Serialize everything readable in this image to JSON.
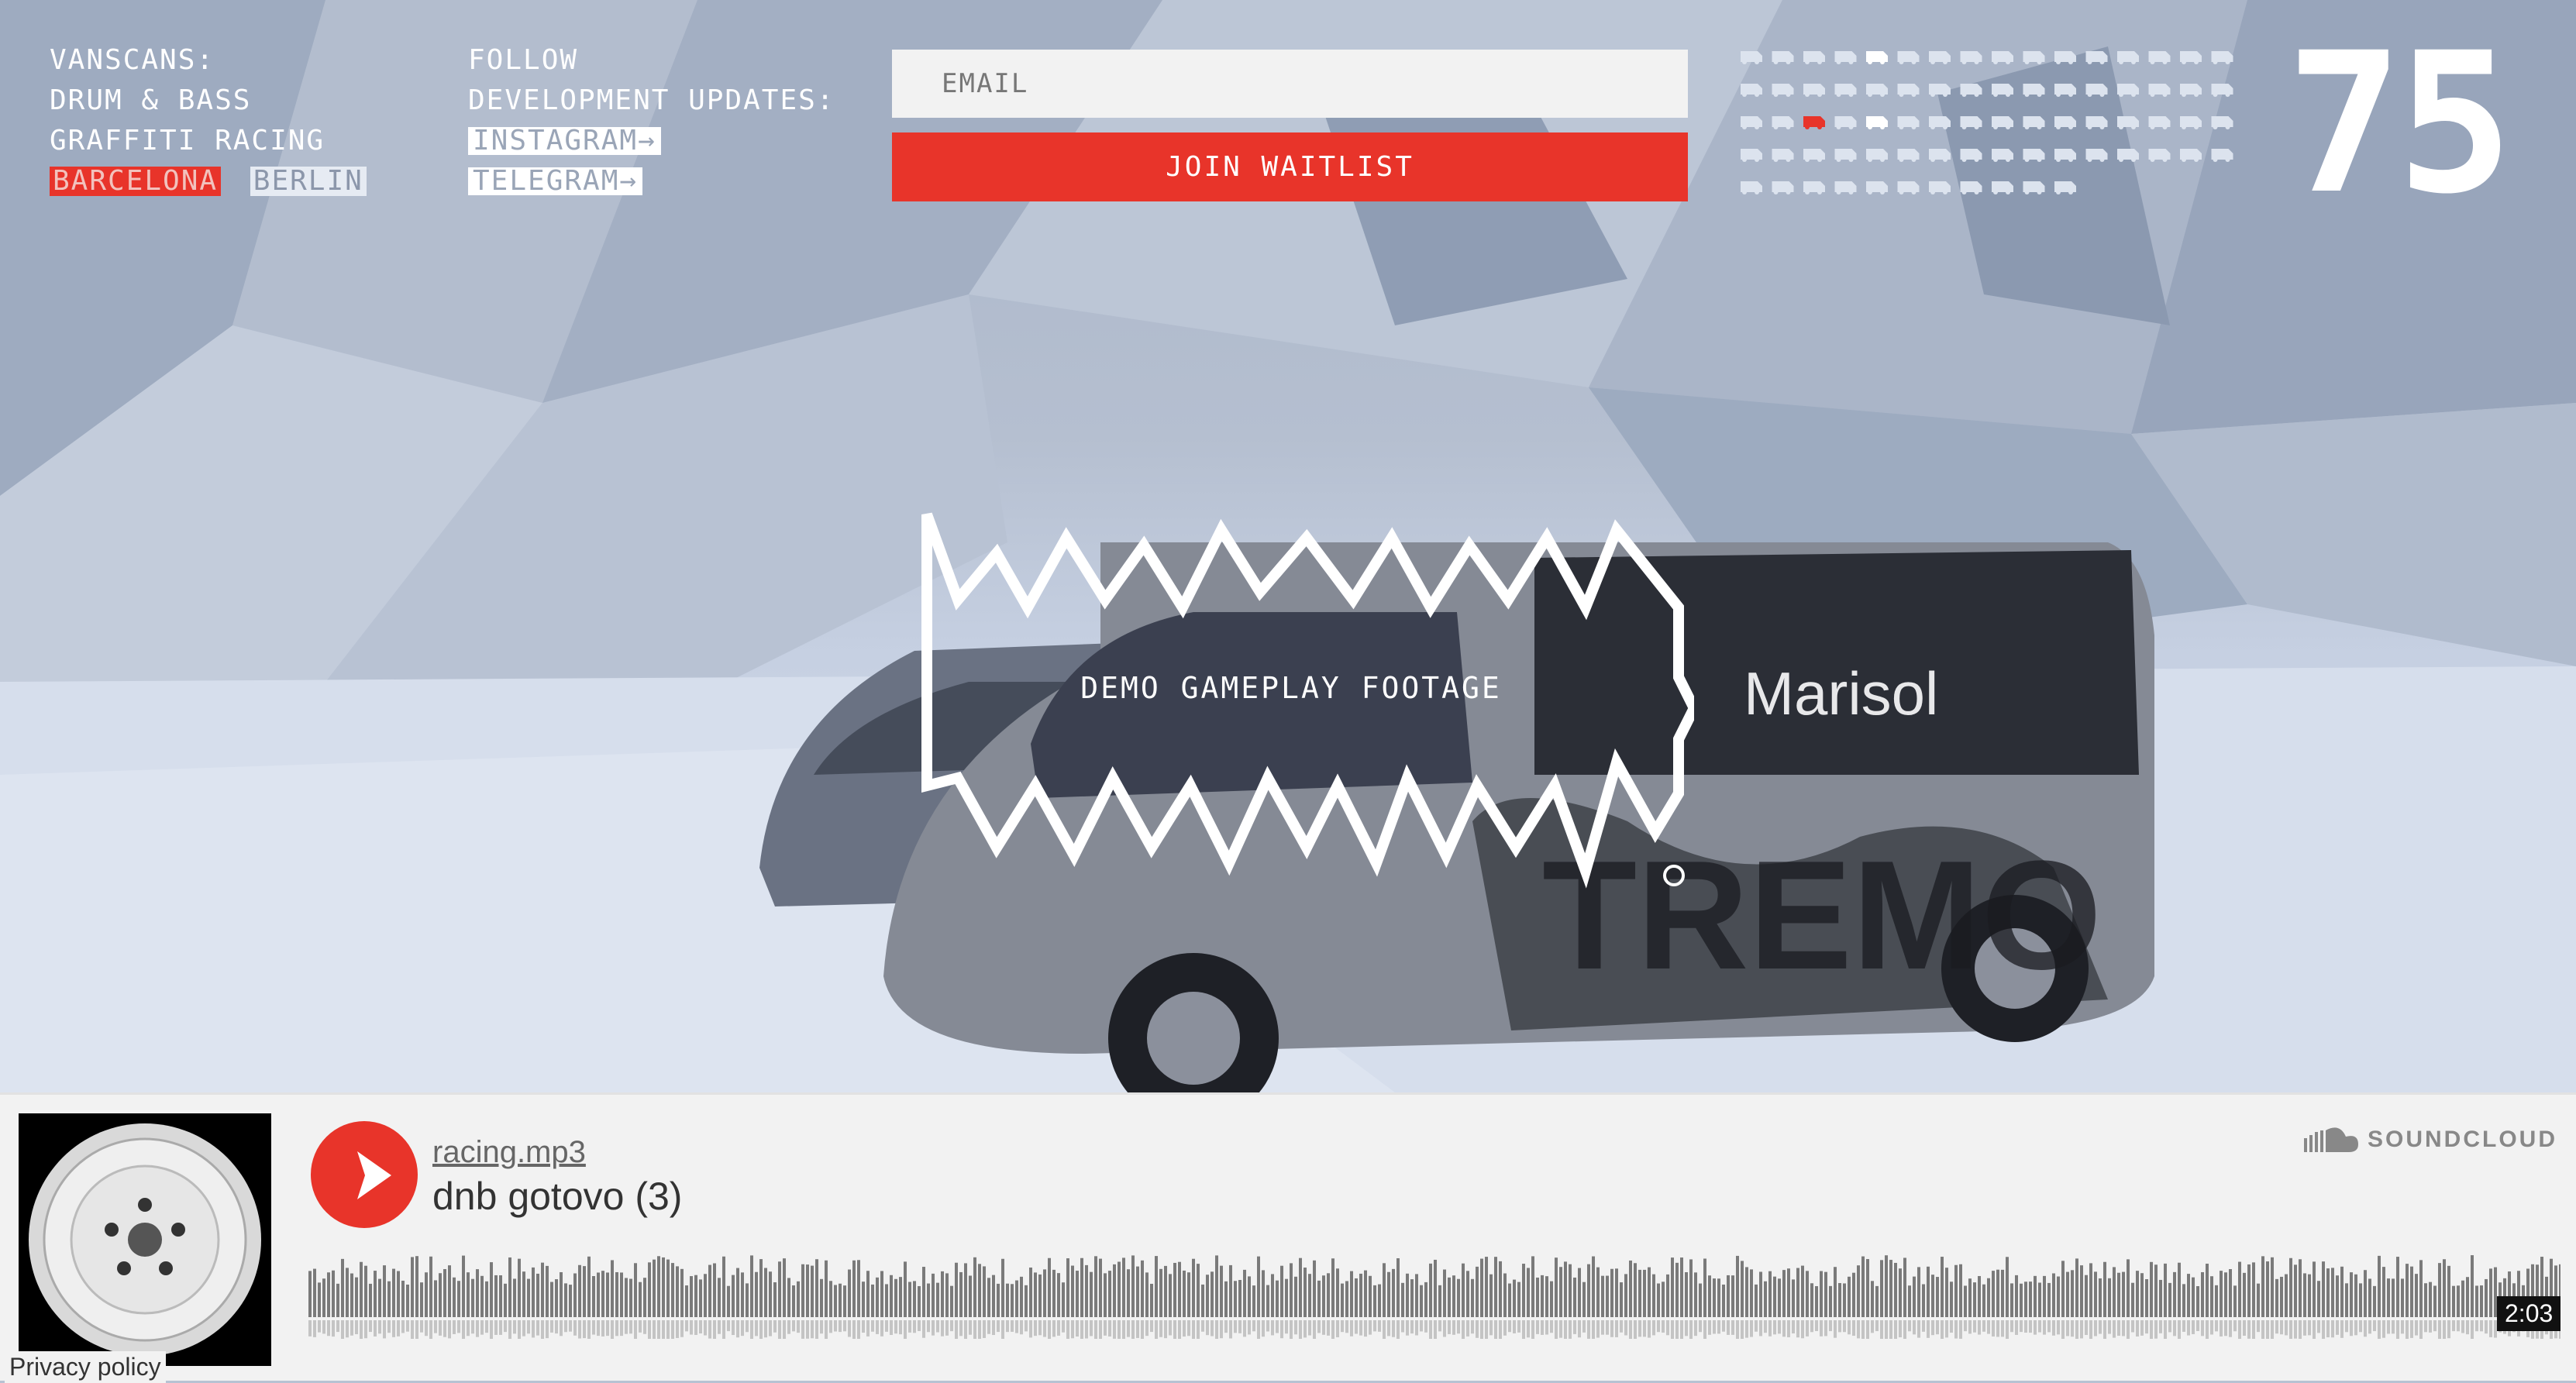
{
  "brand": {
    "line1": "VANSCANS:",
    "line2": "DRUM & BASS",
    "line3": "GRAFFITI RACING",
    "city_active": "BARCELONA",
    "city_other": "BERLIN"
  },
  "follow": {
    "line1": "FOLLOW",
    "line2": "DEVELOPMENT UPDATES:",
    "instagram": "INSTAGRAM→",
    "telegram": "TELEGRAM→"
  },
  "waitlist": {
    "email_placeholder": "EMAIL",
    "join_label": "JOIN WAITLIST"
  },
  "van_counter": {
    "count": "75",
    "active_color": "#e8342a",
    "icon": "van-icon"
  },
  "demo": {
    "label": "DEMO GAMEPLAY FOOTAGE"
  },
  "scene": {
    "van_brand": "Marisol",
    "van_graffiti": "TREMO"
  },
  "player": {
    "user": "racing.mp3",
    "title": "dnb gotovo (3)",
    "provider": "SOUNDCLOUD",
    "duration": "2:03",
    "accent": "#e8342a"
  },
  "footer": {
    "privacy": "Privacy policy"
  }
}
